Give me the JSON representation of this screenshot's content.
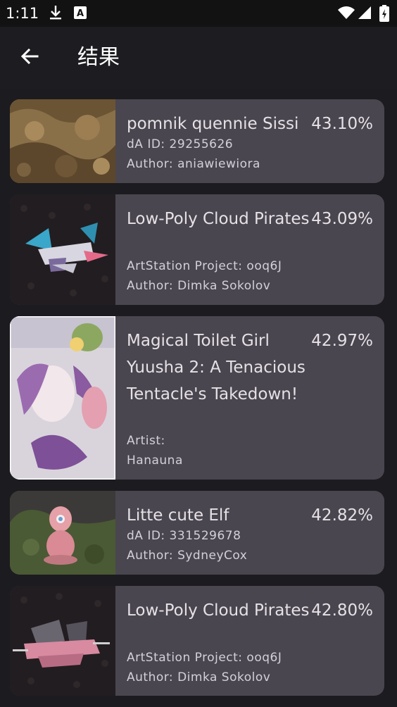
{
  "status_bar": {
    "time": "1:11",
    "icons": [
      "download-icon",
      "a-notification-icon",
      "wifi-icon",
      "signal-icon",
      "battery-icon"
    ]
  },
  "app_bar": {
    "back_icon": "arrow-left-icon",
    "title": "结果"
  },
  "results": [
    {
      "name": "pomnik quennie Sissi",
      "score": "43.10%",
      "line1": "dA ID: 29255626",
      "line2": "Author: aniawiewiora"
    },
    {
      "name": "Low-Poly Cloud Pirates",
      "score": "43.09%",
      "line1": "ArtStation Project: ooq6J",
      "line2": "Author: Dimka Sokolov"
    },
    {
      "name": "Magical Toilet Girl Yuusha 2: A Tenacious Tentacle's Takedown!",
      "score": "42.97%",
      "line1": "Artist:",
      "line2": "Hanauna"
    },
    {
      "name": "Litte cute Elf",
      "score": "42.82%",
      "line1": "dA ID: 331529678",
      "line2": "Author: SydneyCox"
    },
    {
      "name": "Low-Poly Cloud Pirates",
      "score": "42.80%",
      "line1": "ArtStation Project: ooq6J",
      "line2": "Author: Dimka Sokolov"
    }
  ]
}
